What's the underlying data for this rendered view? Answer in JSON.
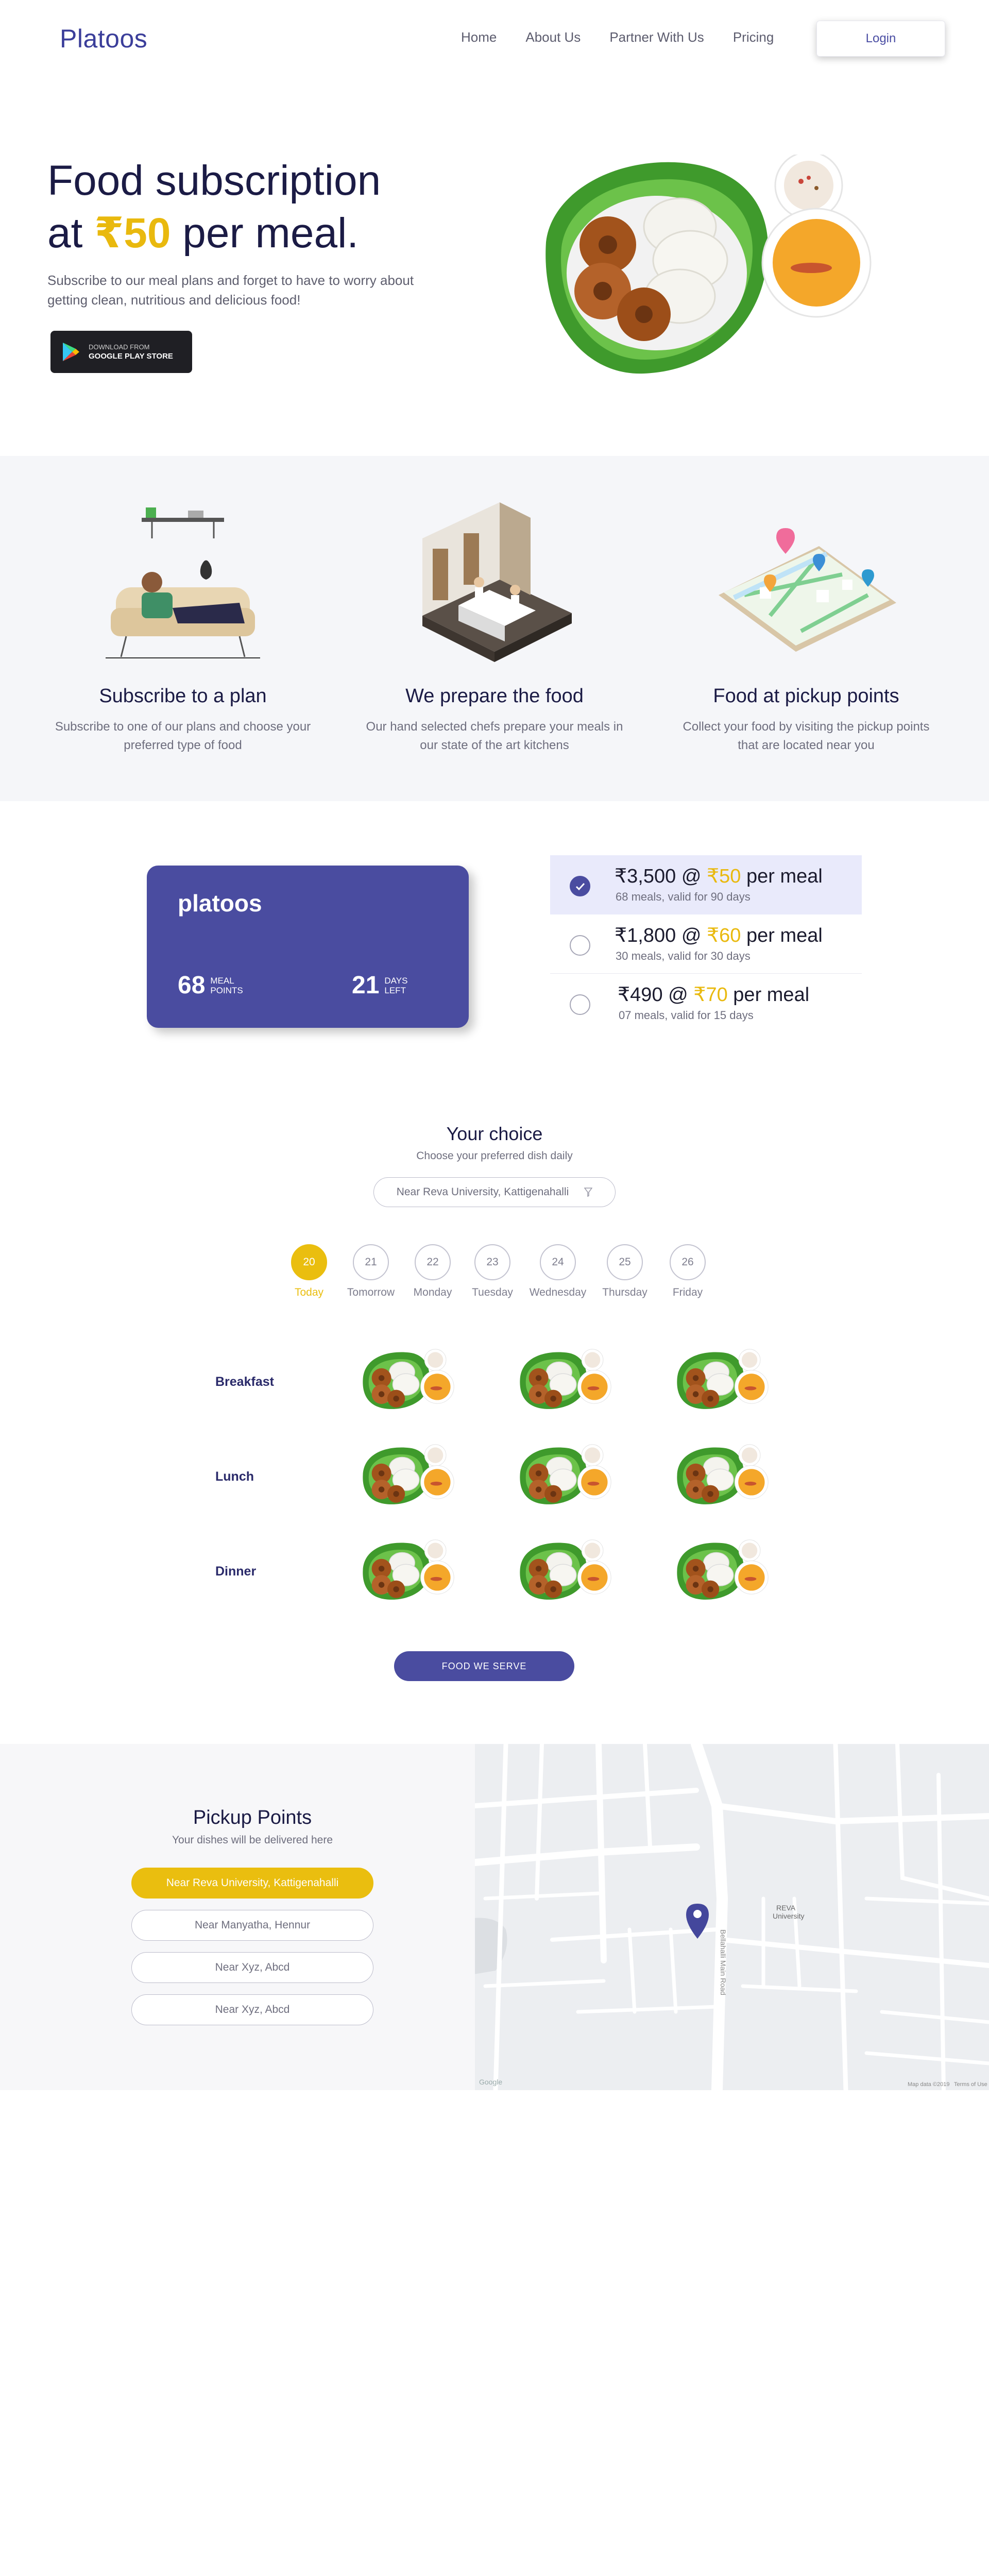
{
  "nav": {
    "logo": "Platoos",
    "links": [
      "Home",
      "About Us",
      "Partner With Us",
      "Pricing"
    ],
    "login": "Login"
  },
  "hero": {
    "title_line1": "Food subscription",
    "title_at": "at",
    "title_price": "₹50",
    "title_rest": "per meal.",
    "subtitle": "Subscribe to our meal plans and forget to have to worry about getting clean, nutritious and delicious food!",
    "store_small": "DOWNLOAD FROM",
    "store_big": "GOOGLE PLAY STORE"
  },
  "how": [
    {
      "title": "Subscribe to a plan",
      "desc": "Subscribe to one of our plans and choose your preferred type of food"
    },
    {
      "title": "We prepare the food",
      "desc": "Our hand selected chefs prepare your meals in our state of the art kitchens"
    },
    {
      "title": "Food at pickup points",
      "desc": "Collect your food by visiting the pickup points that are located near you"
    }
  ],
  "card": {
    "brand": "platoos",
    "meals_num": "68",
    "meals_lbl1": "MEAL",
    "meals_lbl2": "POINTS",
    "days_num": "21",
    "days_lbl1": "DAYS",
    "days_lbl2": "LEFT"
  },
  "plans": [
    {
      "price": "₹3,500 @",
      "rate": "₹50",
      "suffix": "per meal",
      "meta": "68 meals, valid for 90 days",
      "selected": true
    },
    {
      "price": "₹1,800 @",
      "rate": "₹60",
      "suffix": "per meal",
      "meta": "30 meals, valid for 30 days",
      "selected": false
    },
    {
      "price": "₹490 @",
      "rate": "₹70",
      "suffix": "per meal",
      "meta": "07 meals, valid for 15 days",
      "selected": false
    }
  ],
  "choice": {
    "title": "Your choice",
    "subtitle": "Choose your preferred dish daily",
    "location": "Near Reva University, Kattigenahalli",
    "dates": [
      {
        "num": "20",
        "label": "Today",
        "active": true
      },
      {
        "num": "21",
        "label": "Tomorrow",
        "active": false
      },
      {
        "num": "22",
        "label": "Monday",
        "active": false
      },
      {
        "num": "23",
        "label": "Tuesday",
        "active": false
      },
      {
        "num": "24",
        "label": "Wednesday",
        "active": false
      },
      {
        "num": "25",
        "label": "Thursday",
        "active": false
      },
      {
        "num": "26",
        "label": "Friday",
        "active": false
      }
    ],
    "meals": [
      "Breakfast",
      "Lunch",
      "Dinner"
    ],
    "button": "FOOD WE SERVE"
  },
  "pickup": {
    "title": "Pickup Points",
    "subtitle": "Your dishes will be delivered here",
    "options": [
      {
        "label": "Near Reva University, Kattigenahalli",
        "active": true
      },
      {
        "label": "Near Manyatha, Hennur",
        "active": false
      },
      {
        "label": "Near Xyz, Abcd",
        "active": false
      },
      {
        "label": "Near Xyz, Abcd",
        "active": false
      }
    ],
    "map": {
      "road": "Bellahalli Main Road",
      "place1": "REVA",
      "place2": "University",
      "footer_left": "Google",
      "footer_right1": "Map data ©2019",
      "footer_right2": "Terms of Use"
    }
  },
  "colors": {
    "primary": "#4a4ca0",
    "accent": "#eabe0f",
    "text": "#1b1b45"
  }
}
